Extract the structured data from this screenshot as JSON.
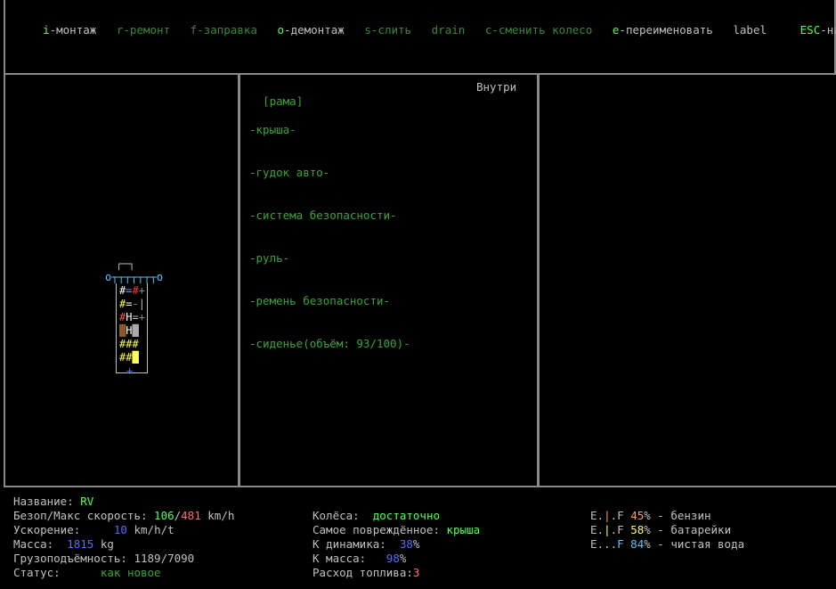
{
  "menu": [
    {
      "key": "i",
      "sep": "-",
      "label": "монтаж",
      "active": true
    },
    {
      "key": "r",
      "sep": "-",
      "label": "ремонт",
      "active": false
    },
    {
      "key": "f",
      "sep": "-",
      "label": "заправка",
      "active": false
    },
    {
      "key": "o",
      "sep": "-",
      "label": "демонтаж",
      "active": true
    },
    {
      "key": "s",
      "sep": "-",
      "label": "слить",
      "active": false
    },
    {
      "key": "",
      "sep": "",
      "label": "drain",
      "active": false
    },
    {
      "key": "c",
      "sep": "-",
      "label": "сменить колесо",
      "active": false
    },
    {
      "key": "e",
      "sep": "-",
      "label": "переименовать",
      "active": true
    },
    {
      "key": "la",
      "sep": "",
      "label": "bel",
      "active": true
    },
    {
      "key": "ESC",
      "sep": "-",
      "label": "назад",
      "active": true
    }
  ],
  "parts_panel": {
    "selected": "[рама]",
    "location": "Внутри",
    "parts": [
      "-крыша-",
      "-гудок авто-",
      "-система безопасности-",
      "-руль-",
      "-ремень безопасности-",
      "-сиденье(объём: 93/100)-"
    ]
  },
  "vehicle_map": {
    "rows": [
      {
        "cells": [
          {
            "t": "┌─┐",
            "c": "#c0c0c0"
          }
        ]
      },
      {
        "cells": [
          {
            "t": "o",
            "c": "#55c8ff"
          },
          {
            "t": "┬┬┬┬┬┬┬",
            "c": "#55c8ff"
          },
          {
            "t": "o",
            "c": "#55c8ff"
          }
        ]
      },
      {
        "cells": [
          {
            "t": "#",
            "c": "#ffffff"
          },
          {
            "t": "=",
            "c": "#8888ff"
          },
          {
            "t": "#",
            "c": "#ff3333"
          },
          {
            "t": "+",
            "c": "#888888"
          }
        ]
      },
      {
        "cells": [
          {
            "t": "#",
            "c": "#ffff55"
          },
          {
            "t": "=",
            "c": "#ffffff"
          },
          {
            "t": "-",
            "c": "#888888"
          },
          {
            "t": "|",
            "c": "#c0c0c0"
          }
        ]
      },
      {
        "cells": [
          {
            "t": "#",
            "c": "#ff5555"
          },
          {
            "t": "H",
            "c": "#ffffff"
          },
          {
            "t": "=",
            "c": "#c0c0c0"
          },
          {
            "t": "+",
            "c": "#888888"
          }
        ]
      },
      {
        "cells": [
          {
            "t": "█",
            "c": "#8a5a2a"
          },
          {
            "t": "H",
            "c": "#ffffff"
          },
          {
            "t": "█",
            "c": "#aaaaaa"
          }
        ]
      },
      {
        "cells": [
          {
            "t": "#",
            "c": "#ffff55"
          },
          {
            "t": "#",
            "c": "#ffff55"
          },
          {
            "t": "#",
            "c": "#ffff55"
          }
        ]
      },
      {
        "cells": [
          {
            "t": "#",
            "c": "#ffff55"
          },
          {
            "t": "#",
            "c": "#ffff55"
          },
          {
            "t": "█",
            "c": "#ffff55"
          }
        ]
      },
      {
        "cells": [
          {
            "t": "+",
            "c": "#5a6aff"
          }
        ]
      }
    ]
  },
  "status": {
    "name_label": "Название:",
    "name": "RV",
    "speed_label": "Безоп/Макс скорость:",
    "safe_speed": "106",
    "slash": "/",
    "max_speed": "481",
    "speed_unit": "km/h",
    "accel_label": "Ускорение:",
    "accel": "10",
    "accel_unit": "km/h/t",
    "mass_label": "Масса:",
    "mass": "1815",
    "mass_unit": "kg",
    "cargo_label": "Грузоподъёмность:",
    "cargo": "1189/7090",
    "state_label": "Статус:",
    "state": "как новое",
    "wheels_label": "Колёса:",
    "wheels": "достаточно",
    "damaged_label": "Самое повреждённое:",
    "damaged": "крыша",
    "k_dyn_label": "К динамика:",
    "k_dyn": "38",
    "pct": "%",
    "k_mass_label": "К масса:",
    "k_mass": "98",
    "fuel_label": "Расход топлива:",
    "fuel": "3"
  },
  "tanks": [
    {
      "gauge_e": "E.",
      "gauge_mid": "|",
      "gauge_f": ".F",
      "pct": "45",
      "pct_sign": "%",
      "name": " - бензин",
      "color": "#ff9a5a"
    },
    {
      "gauge_e": "E.",
      "gauge_mid": "|",
      "gauge_f": ".F",
      "pct": "58",
      "pct_sign": "%",
      "name": " - батарейки",
      "color": "#ffff55"
    },
    {
      "gauge_e": "E...",
      "gauge_mid": "",
      "gauge_f": "F",
      "pct": "84",
      "pct_sign": "%",
      "name": " - чистая вода",
      "color": "#55c8ff"
    }
  ],
  "colors": {
    "frame": "#8a8a8a",
    "accent_green": "#55ff55",
    "dim_green": "#3aa53a"
  }
}
